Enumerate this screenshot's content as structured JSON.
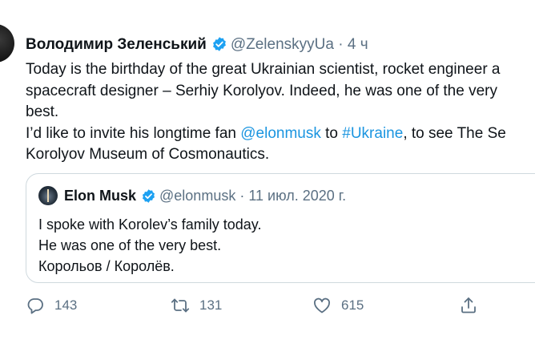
{
  "tweet": {
    "author_name": "Володимир Зеленський",
    "handle": "@ZelenskyyUa",
    "separator": "·",
    "time": "4 ч",
    "text_lines": [
      "Today is the birthday of the great Ukrainian scientist, rocket engineer a",
      "spacecraft designer – Serhiy Korolyov. Indeed, he was one of the very",
      "best."
    ],
    "line4_pre": "I’d like to invite his longtime fan ",
    "mention": "@elonmusk",
    "line4_mid": " to ",
    "hashtag": "#Ukraine",
    "line4_post": ", to see The Se",
    "line5": "Korolyov Museum of Cosmonautics."
  },
  "quote": {
    "author_name": "Elon Musk",
    "handle": "@elonmusk",
    "separator": "·",
    "date": "11 июл. 2020 г.",
    "lines": [
      "I spoke with Korolev’s family today.",
      "He was one of the very best.",
      "Корольов / Королёв."
    ]
  },
  "actions": {
    "replies": "143",
    "retweets": "131",
    "likes": "615"
  },
  "colors": {
    "link": "#1b95e0",
    "verified": "#1da1f2",
    "muted": "#5b7083",
    "border": "#cfd9de"
  },
  "icons": [
    "verified-badge-icon",
    "reply-icon",
    "retweet-icon",
    "like-icon",
    "share-icon"
  ]
}
